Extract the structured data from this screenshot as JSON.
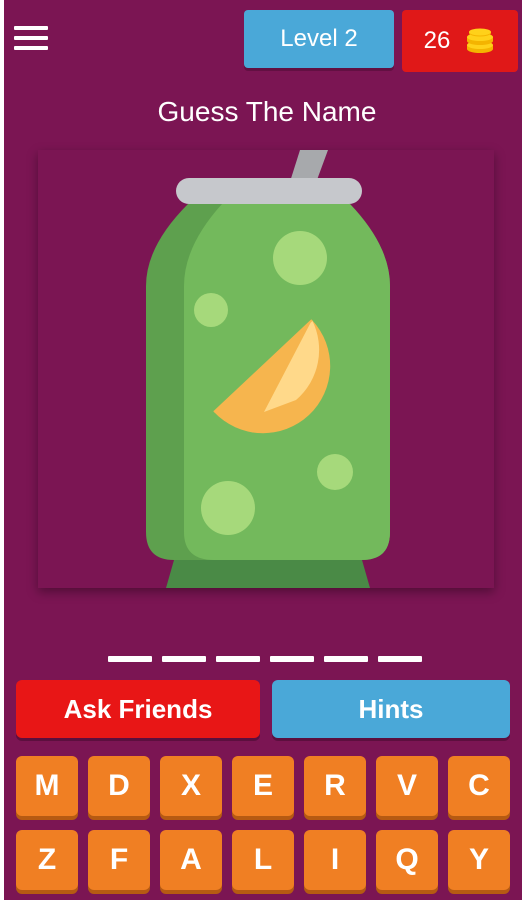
{
  "header": {
    "level_label": "Level 2",
    "coins": "26",
    "coin_icon": "coins-icon",
    "menu_icon": "hamburger-menu-icon"
  },
  "title": "Guess The Name",
  "puzzle": {
    "image_icon": "soda-can-icon",
    "answer_slots": 6
  },
  "buttons": {
    "ask_friends": "Ask Friends",
    "hints": "Hints"
  },
  "keyboard": {
    "row1": [
      "M",
      "D",
      "X",
      "E",
      "R",
      "V",
      "C"
    ],
    "row2": [
      "Z",
      "F",
      "A",
      "L",
      "I",
      "Q",
      "Y"
    ]
  },
  "colors": {
    "background": "#7b1553",
    "level_button": "#4aa8d8",
    "coins_button": "#e01818",
    "ask_button": "#e81616",
    "hints_button": "#4aa8d8",
    "key": "#f07f23",
    "can_green": "#72b85d"
  }
}
